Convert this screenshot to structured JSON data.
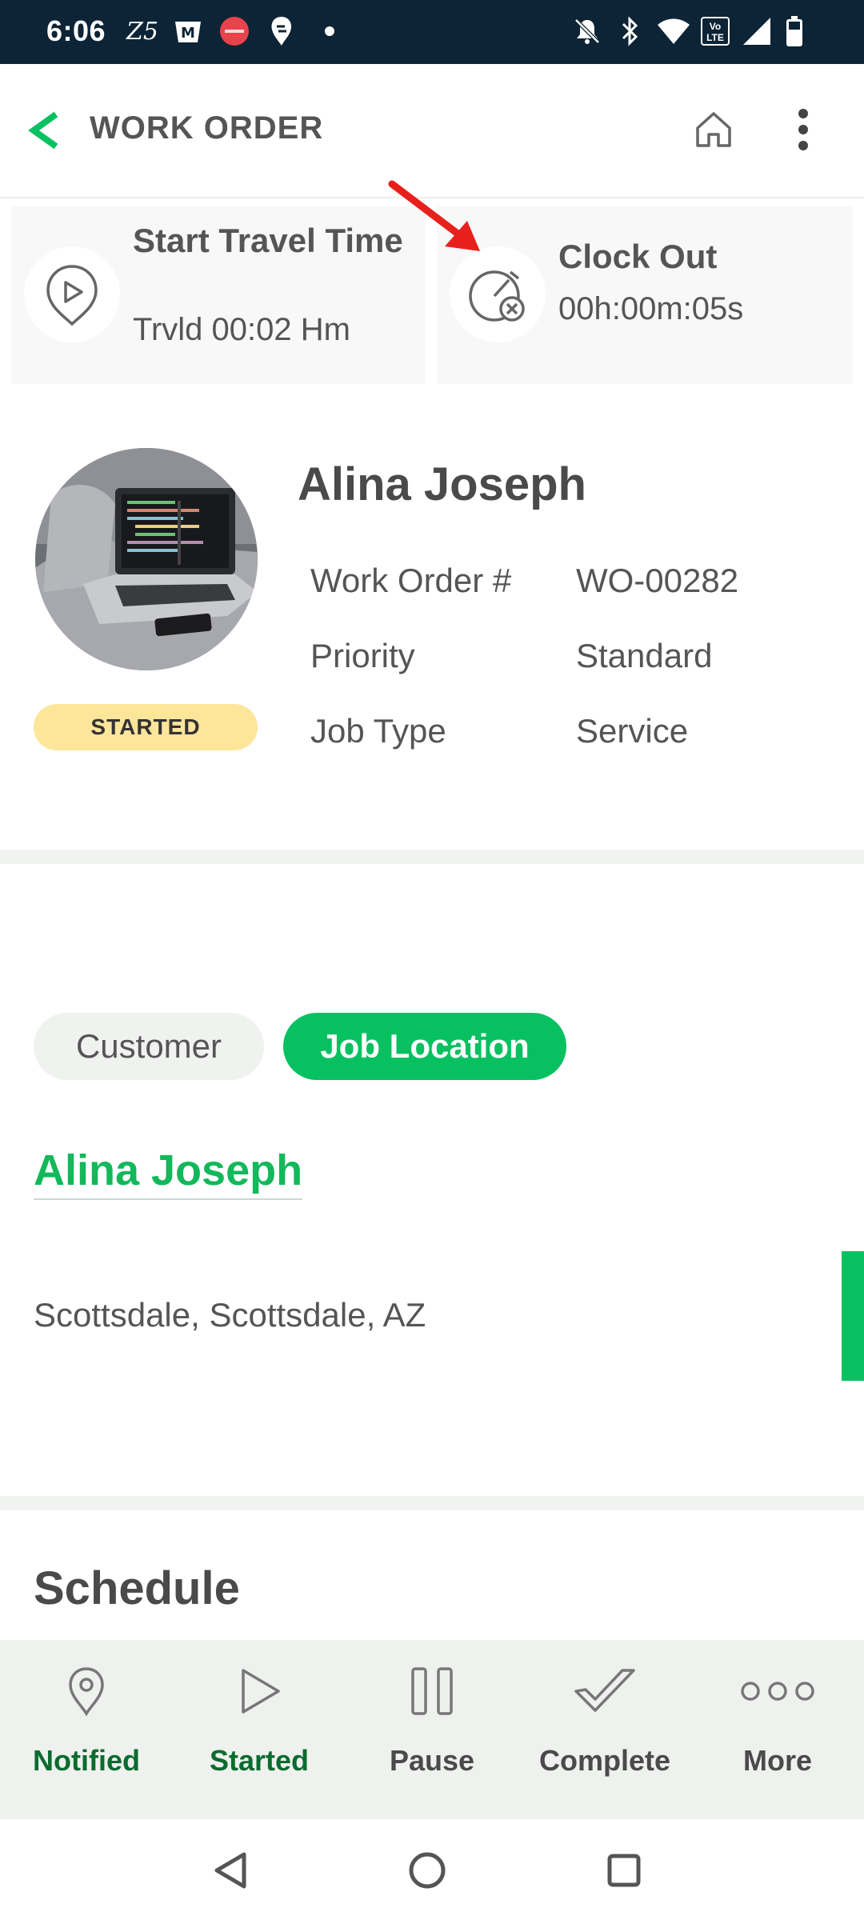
{
  "status_bar": {
    "time": "6:06",
    "icons": [
      "zee5-icon",
      "myntra-icon",
      "nearbuy-icon",
      "swiggy-icon",
      "dot-icon",
      "mute-icon",
      "bluetooth-icon",
      "wifi-icon",
      "volte-icon",
      "signal-icon",
      "battery-icon"
    ],
    "z5_text": "Z5",
    "volte_text": "Vo LTE"
  },
  "app_bar": {
    "title": "WORK ORDER"
  },
  "time_cards": {
    "travel": {
      "title": "Start Travel Time",
      "value": "Trvld 00:02 Hm",
      "icon": "travel-pin-play-icon"
    },
    "clock": {
      "title": "Clock Out",
      "value": "00h:00m:05s",
      "icon": "stopwatch-cancel-icon"
    }
  },
  "profile": {
    "name": "Alina Joseph",
    "status": "STARTED",
    "fields": [
      {
        "label": "Work Order #",
        "value": "WO-00282"
      },
      {
        "label": "Priority",
        "value": "Standard"
      },
      {
        "label": "Job Type",
        "value": "Service"
      }
    ]
  },
  "tabs": [
    {
      "label": "Customer",
      "active": false
    },
    {
      "label": "Job Location",
      "active": true
    }
  ],
  "location": {
    "contact_name": "Alina Joseph",
    "address": "Scottsdale, Scottsdale, AZ"
  },
  "schedule": {
    "title": "Schedule"
  },
  "actions": [
    {
      "label": "Notified",
      "icon": "location-pin-icon",
      "color": "#0b6b2e"
    },
    {
      "label": "Started",
      "icon": "play-icon",
      "color": "#0b6b2e"
    },
    {
      "label": "Pause",
      "icon": "pause-icon",
      "color": "#4a4a4a"
    },
    {
      "label": "Complete",
      "icon": "checkmark-icon",
      "color": "#4a4a4a"
    },
    {
      "label": "More",
      "icon": "more-dots-icon",
      "color": "#4a4a4a"
    }
  ],
  "colors": {
    "accent": "#07c160",
    "badge": "#fde59a",
    "status_bar": "#0d2436"
  }
}
